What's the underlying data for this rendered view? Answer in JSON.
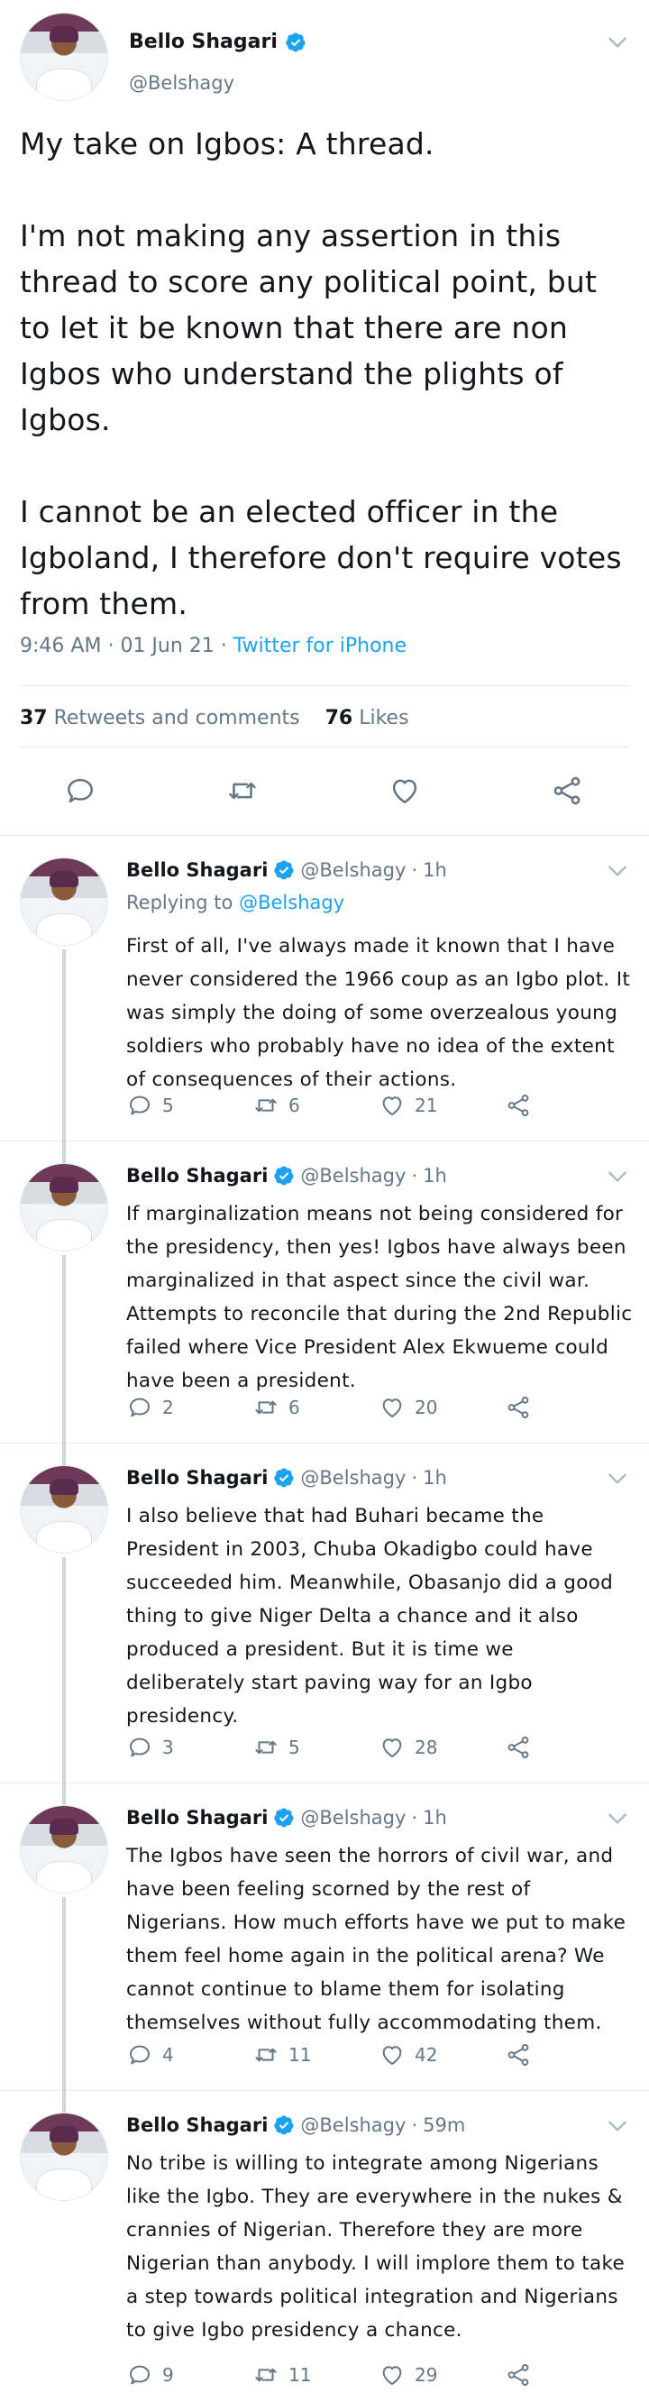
{
  "author": {
    "name": "Bello Shagari",
    "handle": "@Belshagy"
  },
  "main_tweet": {
    "text": "My take on Igbos: A thread.\n\nI'm not making any assertion in this thread to score any political point, but to let it be known that there are non Igbos who understand the plights of Igbos.\n\nI cannot be an elected officer in the Igboland, I therefore don't require votes from them.",
    "time": "9:46 AM",
    "date": "01 Jun 21",
    "source": "Twitter for iPhone",
    "retweets_count": "37",
    "retweets_label": "Retweets and comments",
    "likes_count": "76",
    "likes_label": "Likes"
  },
  "replies": [
    {
      "name": "Bello Shagari",
      "handle": "@Belshagy",
      "age": "1h",
      "replying_label": "Replying to",
      "replying_to": "@Belshagy",
      "text": "First of all, I've always made it known that I have never considered the 1966 coup as an Igbo plot. It was simply the doing of some overzealous young soldiers who probably have no idea of the extent of consequences of their actions.",
      "replies": "5",
      "retweets": "6",
      "likes": "21"
    },
    {
      "name": "Bello Shagari",
      "handle": "@Belshagy",
      "age": "1h",
      "text": "If marginalization means not being considered for the presidency, then yes! Igbos have always been marginalized in that aspect since the civil war. Attempts to reconcile that during the 2nd Republic failed where Vice President Alex Ekwueme could have been a president.",
      "replies": "2",
      "retweets": "6",
      "likes": "20"
    },
    {
      "name": "Bello Shagari",
      "handle": "@Belshagy",
      "age": "1h",
      "text": "I also believe that had Buhari became the President in 2003, Chuba Okadigbo could have succeeded him. Meanwhile, Obasanjo did a good thing to give Niger Delta a chance and it also produced a president. But it is time we deliberately start paving way for an Igbo presidency.",
      "replies": "3",
      "retweets": "5",
      "likes": "28"
    },
    {
      "name": "Bello Shagari",
      "handle": "@Belshagy",
      "age": "1h",
      "text": "The Igbos have seen the horrors of civil war, and have been feeling scorned by the rest of Nigerians. How much efforts have we put to make them feel home again in the political arena? We cannot continue to blame them for isolating themselves without fully accommodating them.",
      "replies": "4",
      "retweets": "11",
      "likes": "42"
    },
    {
      "name": "Bello Shagari",
      "handle": "@Belshagy",
      "age": "59m",
      "text": "No tribe is willing to integrate among Nigerians like the Igbo. They are everywhere in the nukes & crannies of Nigerian. Therefore they are more Nigerian than anybody. I will implore them to take a step towards political integration and Nigerians to give Igbo presidency a chance.",
      "replies": "9",
      "retweets": "11",
      "likes": "29"
    }
  ],
  "colors": {
    "accent": "#1da1f2",
    "text": "#14171a",
    "muted": "#657786",
    "divider": "#e6ecf0",
    "thread_line": "#ccd6dd"
  },
  "icons": [
    "verified-badge-icon",
    "chevron-down-icon",
    "reply-icon",
    "retweet-icon",
    "like-icon",
    "share-icon"
  ]
}
